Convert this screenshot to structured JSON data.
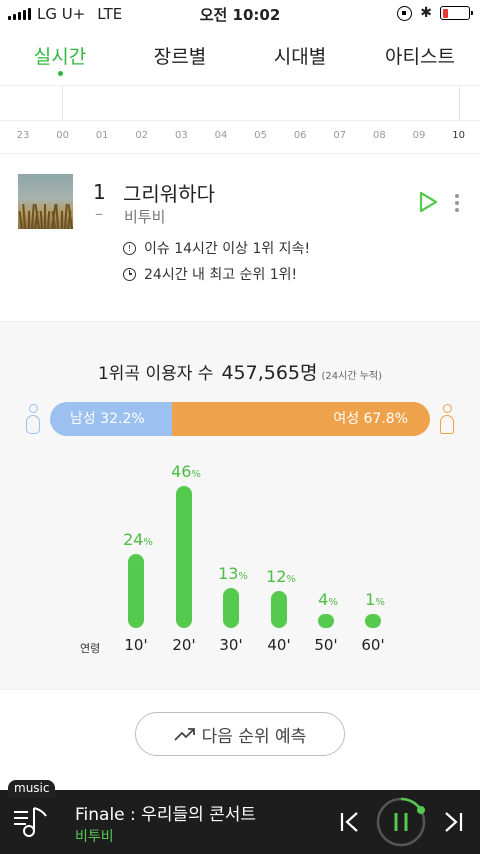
{
  "status_bar": {
    "carrier": "LG U+",
    "network": "LTE",
    "time": "오전 10:02",
    "battery_level": 0.22
  },
  "tabs": [
    {
      "label": "실시간",
      "active": true
    },
    {
      "label": "장르별",
      "active": false
    },
    {
      "label": "시대별",
      "active": false
    },
    {
      "label": "아티스트",
      "active": false
    }
  ],
  "timeline": {
    "hours": [
      "23",
      "00",
      "01",
      "02",
      "03",
      "04",
      "05",
      "06",
      "07",
      "08",
      "09",
      "10"
    ],
    "current": "10"
  },
  "song": {
    "rank": "1",
    "rank_change": "–",
    "title": "그리워하다",
    "artist": "비투비",
    "info_1": "이슈 14시간 이상 1위 지속!",
    "info_2": "24시간 내 최고 순위 1위!",
    "info_1_icon": "issue-icon",
    "info_2_icon": "clock-icon"
  },
  "stats": {
    "users_label": "1위곡 이용자 수",
    "users_count": "457,565명",
    "users_sub": "(24시간 누적)",
    "male_label": "남성 32.2%",
    "female_label": "여성 67.8%",
    "male_pct": 32.2,
    "female_pct": 67.8,
    "male_color": "#9cc1f0",
    "female_color": "#efa24c",
    "age_title": "연령"
  },
  "chart_data": {
    "type": "bar",
    "categories": [
      "10'",
      "20'",
      "30'",
      "40'",
      "50'",
      "60'"
    ],
    "values": [
      24,
      46,
      13,
      12,
      4,
      1
    ],
    "unit": "%",
    "color": "#56c94f"
  },
  "predict_button": "다음 순위 예측",
  "player": {
    "tag": "music",
    "title": "Finale : 우리들의 콘서트",
    "artist": "비투비",
    "accent": "#56c94f"
  }
}
